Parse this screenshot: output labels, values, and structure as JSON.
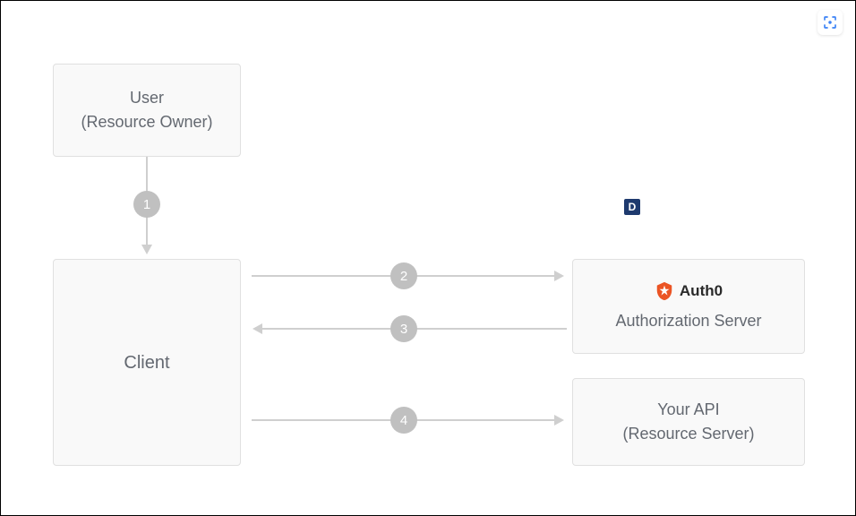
{
  "nodes": {
    "user": {
      "line1": "User",
      "line2": "(Resource Owner)"
    },
    "client": {
      "label": "Client"
    },
    "authserver": {
      "brand": "Auth0",
      "label": "Authorization Server"
    },
    "api": {
      "line1": "Your API",
      "line2": "(Resource Server)"
    }
  },
  "steps": {
    "s1": "1",
    "s2": "2",
    "s3": "3",
    "s4": "4"
  },
  "badge": {
    "d": "D"
  },
  "colors": {
    "boxBg": "#f9f9f9",
    "boxBorder": "#e0e0e0",
    "text": "#636870",
    "arrow": "#cfcfcf",
    "stepCircle": "#c0c0c0",
    "auth0Orange": "#eb5424",
    "cornerIconBlue": "#3b82f6",
    "dBadge": "#1e3a6e"
  },
  "chart_data": {
    "type": "flow-diagram",
    "nodes": [
      {
        "id": "user",
        "label": "User (Resource Owner)"
      },
      {
        "id": "client",
        "label": "Client"
      },
      {
        "id": "authserver",
        "label": "Auth0 Authorization Server"
      },
      {
        "id": "api",
        "label": "Your API (Resource Server)"
      }
    ],
    "edges": [
      {
        "step": 1,
        "from": "user",
        "to": "client",
        "direction": "down"
      },
      {
        "step": 2,
        "from": "client",
        "to": "authserver",
        "direction": "right"
      },
      {
        "step": 3,
        "from": "authserver",
        "to": "client",
        "direction": "left"
      },
      {
        "step": 4,
        "from": "client",
        "to": "api",
        "direction": "right"
      }
    ]
  }
}
